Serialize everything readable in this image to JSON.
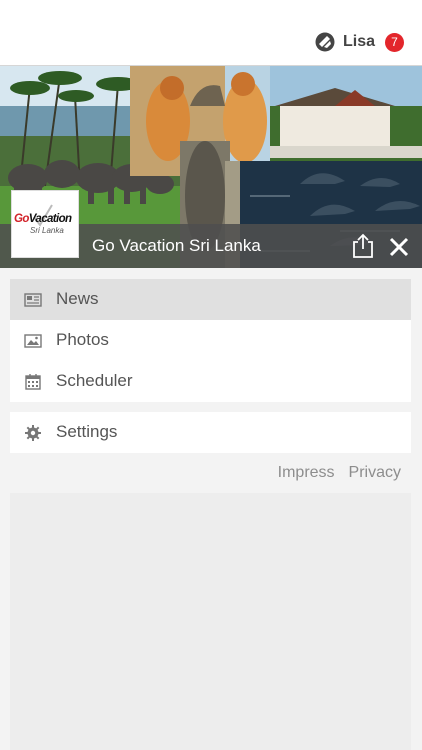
{
  "header": {
    "user_name": "Lisa",
    "notification_count": "7",
    "badge_color": "#e3262b",
    "logo_icon": "app-brand-icon"
  },
  "banner": {
    "title": "Go Vacation Sri Lanka",
    "share_icon": "share-icon",
    "close_icon": "close-icon",
    "logo_text_go": "Go",
    "logo_text_vacation": "Vacation",
    "logo_text_sub": "Sri Lanka"
  },
  "menu": {
    "main_items": [
      {
        "label": "News",
        "icon": "newspaper-icon",
        "active": true
      },
      {
        "label": "Photos",
        "icon": "image-icon",
        "active": false
      },
      {
        "label": "Scheduler",
        "icon": "calendar-icon",
        "active": false
      }
    ],
    "settings": {
      "label": "Settings",
      "icon": "gear-icon"
    }
  },
  "footer_links": {
    "impress": "Impress",
    "privacy": "Privacy"
  }
}
